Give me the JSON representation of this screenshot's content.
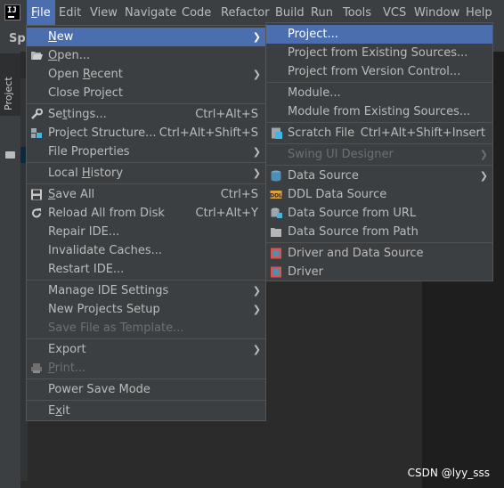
{
  "menubar": {
    "items": [
      "File",
      "Edit",
      "View",
      "Navigate",
      "Code",
      "Refactor",
      "Build",
      "Run",
      "Tools",
      "VCS",
      "Window",
      "Help"
    ],
    "active": "File"
  },
  "toolbar": {
    "project_label": "Spr"
  },
  "tool_window": {
    "project_tab": "Project"
  },
  "file_menu": {
    "items": [
      {
        "label": "New",
        "mnemonic": "N",
        "submenu": true,
        "selected": true
      },
      {
        "label": "Open...",
        "mnemonic": "O",
        "icon": "folder-open-icon"
      },
      {
        "label": "Open Recent",
        "mnemonic": "R",
        "submenu": true
      },
      {
        "label": "Close Project"
      },
      {
        "label": "Settings...",
        "mnemonic": "t",
        "shortcut": "Ctrl+Alt+S",
        "icon": "wrench-icon"
      },
      {
        "label": "Project Structure...",
        "shortcut": "Ctrl+Alt+Shift+S",
        "icon": "project-structure-icon"
      },
      {
        "label": "File Properties",
        "submenu": true
      },
      {
        "label": "Local History",
        "mnemonic": "H",
        "submenu": true
      },
      {
        "label": "Save All",
        "mnemonic": "S",
        "shortcut": "Ctrl+S",
        "icon": "save-icon"
      },
      {
        "label": "Reload All from Disk",
        "shortcut": "Ctrl+Alt+Y",
        "icon": "reload-icon"
      },
      {
        "label": "Repair IDE..."
      },
      {
        "label": "Invalidate Caches..."
      },
      {
        "label": "Restart IDE..."
      },
      {
        "label": "Manage IDE Settings",
        "submenu": true
      },
      {
        "label": "New Projects Setup",
        "submenu": true
      },
      {
        "label": "Save File as Template...",
        "disabled": true
      },
      {
        "label": "Export",
        "submenu": true
      },
      {
        "label": "Print...",
        "mnemonic": "P",
        "disabled": true,
        "icon": "printer-icon"
      },
      {
        "label": "Power Save Mode"
      },
      {
        "label": "Exit",
        "mnemonic": "x"
      }
    ]
  },
  "new_submenu": {
    "items": [
      {
        "label": "Project...",
        "selected": true
      },
      {
        "label": "Project from Existing Sources..."
      },
      {
        "label": "Project from Version Control..."
      },
      {
        "label": "Module..."
      },
      {
        "label": "Module from Existing Sources..."
      },
      {
        "label": "Scratch File",
        "shortcut": "Ctrl+Alt+Shift+Insert",
        "icon": "scratch-file-icon"
      },
      {
        "label": "Swing UI Designer",
        "disabled": true,
        "submenu": true
      },
      {
        "label": "Data Source",
        "submenu": true,
        "icon": "database-icon"
      },
      {
        "label": "DDL Data Source",
        "icon": "ddl-icon"
      },
      {
        "label": "Data Source from URL",
        "icon": "database-url-icon"
      },
      {
        "label": "Data Source from Path",
        "icon": "folder-path-icon"
      },
      {
        "label": "Driver and Data Source",
        "icon": "driver-datasource-icon"
      },
      {
        "label": "Driver",
        "icon": "driver-icon"
      }
    ]
  },
  "watermark": "CSDN @lyy_sss",
  "colors": {
    "menu_bg": "#3c3f41",
    "selection": "#4b6eaf",
    "text": "#bbbbbb",
    "disabled": "#6f6f6f"
  }
}
